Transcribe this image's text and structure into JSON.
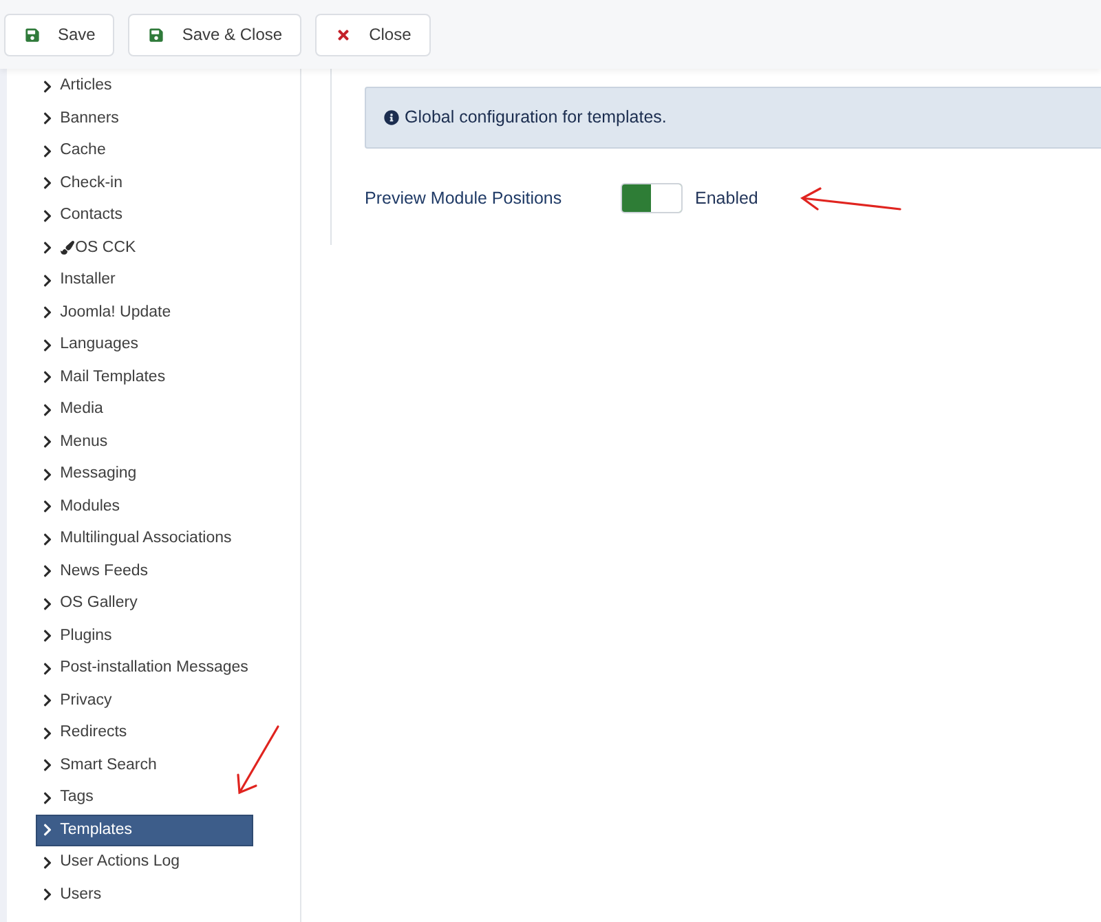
{
  "toolbar": {
    "buttons": [
      {
        "kind": "save",
        "label": "Save"
      },
      {
        "kind": "save",
        "label": "Save & Close"
      },
      {
        "kind": "close",
        "label": "Close"
      }
    ]
  },
  "sidebar": {
    "items": [
      {
        "label": "Articles",
        "kind": "plain",
        "selected": false
      },
      {
        "label": "Banners",
        "kind": "plain",
        "selected": false
      },
      {
        "label": "Cache",
        "kind": "plain",
        "selected": false
      },
      {
        "label": "Check-in",
        "kind": "plain",
        "selected": false
      },
      {
        "label": "Contacts",
        "kind": "plain",
        "selected": false
      },
      {
        "label": "OS CCK",
        "kind": "with-icon",
        "selected": false
      },
      {
        "label": "Installer",
        "kind": "plain",
        "selected": false
      },
      {
        "label": "Joomla! Update",
        "kind": "plain",
        "selected": false
      },
      {
        "label": "Languages",
        "kind": "plain",
        "selected": false
      },
      {
        "label": "Mail Templates",
        "kind": "plain",
        "selected": false
      },
      {
        "label": "Media",
        "kind": "plain",
        "selected": false
      },
      {
        "label": "Menus",
        "kind": "plain",
        "selected": false
      },
      {
        "label": "Messaging",
        "kind": "plain",
        "selected": false
      },
      {
        "label": "Modules",
        "kind": "plain",
        "selected": false
      },
      {
        "label": "Multilingual Associations",
        "kind": "plain",
        "selected": false
      },
      {
        "label": "News Feeds",
        "kind": "plain",
        "selected": false
      },
      {
        "label": "OS Gallery",
        "kind": "plain",
        "selected": false
      },
      {
        "label": "Plugins",
        "kind": "plain",
        "selected": false
      },
      {
        "label": "Post-installation Messages",
        "kind": "plain",
        "selected": false
      },
      {
        "label": "Privacy",
        "kind": "plain",
        "selected": false
      },
      {
        "label": "Redirects",
        "kind": "plain",
        "selected": false
      },
      {
        "label": "Smart Search",
        "kind": "plain",
        "selected": false
      },
      {
        "label": "Tags",
        "kind": "plain",
        "selected": false
      },
      {
        "label": "Templates",
        "kind": "plain",
        "selected": true
      },
      {
        "label": "User Actions Log",
        "kind": "plain",
        "selected": false
      },
      {
        "label": "Users",
        "kind": "plain",
        "selected": false
      }
    ]
  },
  "content": {
    "alert": {
      "text": "Global configuration for templates."
    },
    "fields": [
      {
        "kind": "switch",
        "label": "Preview Module Positions",
        "on": true,
        "state_label": "Enabled"
      }
    ]
  }
}
